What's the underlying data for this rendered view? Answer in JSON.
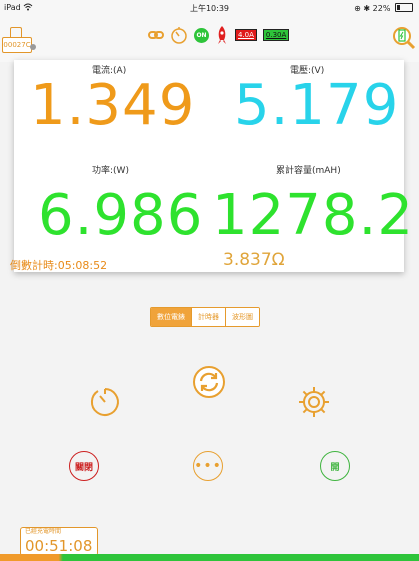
{
  "status_bar": {
    "device": "iPad",
    "time": "上午10:39",
    "battery": "22%"
  },
  "header": {
    "device_id": "00027C",
    "on_label": "ON",
    "current_badge_red": "4.0A",
    "current_badge_green": "0.30A"
  },
  "readings": {
    "current_label": "電流:(A)",
    "current_value": "1.349",
    "voltage_label": "電壓:(V)",
    "voltage_value": "5.179",
    "power_label": "功率:(W)",
    "power_value": "6.986",
    "capacity_label": "累計容量(mAH)",
    "capacity_value": "1278.2",
    "countdown": "倒數計時:05:08:52",
    "resistance": "3.837Ω"
  },
  "tabs": [
    {
      "label": "數位電錶",
      "active": true
    },
    {
      "label": "計時器",
      "active": false
    },
    {
      "label": "波形圖",
      "active": false
    }
  ],
  "buttons": {
    "off_label": "關閉",
    "more_label": "•••",
    "on_label": "開"
  },
  "charge": {
    "label": "已經充電時間",
    "time": "00:51:08",
    "progress": 1.0
  },
  "colors": {
    "orange": "#ef9a1a",
    "cyan": "#28d3ea",
    "green": "#2ee22e",
    "red": "#cc1f1f",
    "progress_start": "#f09a2a",
    "progress_end": "#2ec43a"
  },
  "icons": [
    "wifi-icon",
    "lock-rotation-icon",
    "link-icon",
    "timer-icon",
    "rocket-icon",
    "battery-search-icon",
    "timer-reset-icon",
    "refresh-icon",
    "gear-icon",
    "device-icon"
  ]
}
